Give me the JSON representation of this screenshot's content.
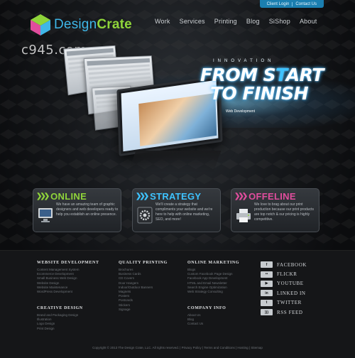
{
  "colors": {
    "brand_blue": "#3fb7e8",
    "brand_green": "#8fd43a",
    "accent_pink": "#e04d9d",
    "util_bar": "#1b7fb0"
  },
  "util": {
    "login": "Client Login",
    "contact": "Contact Us"
  },
  "logo": {
    "part1": "Design",
    "part2": "Crate",
    "icon": "cube-logo-icon"
  },
  "nav": [
    "Work",
    "Services",
    "Printing",
    "Blog",
    "SiShop",
    "About"
  ],
  "watermark": "c945.com",
  "hero": {
    "kicker": "INNOVATION",
    "title_pre": "FROM S",
    "title_accent": "T",
    "title_post": "ART",
    "title_line2": "TO FINISH",
    "caption": "Web Development"
  },
  "services": [
    {
      "title": "ONLINE",
      "icon": "monitor-icon",
      "desc": "We have an amazing team of graphic designers and web developers ready to help you establish an online presence."
    },
    {
      "title": "STRATEGY",
      "icon": "gear-icon",
      "desc": "We'll create a strategy that compliments your website and we're here to help with online marketing, SEO, and more!"
    },
    {
      "title": "OFFELINE",
      "icon": "printer-icon",
      "desc": "We love to brag about our print production because our print products are top notch & our pricing is highly competitive."
    }
  ],
  "footer": {
    "web_dev": {
      "heading": "WEBSITE DEVELOPMENT",
      "items": [
        "Content Management System",
        "Ecommerce Development",
        "Small Business Web Design",
        "Website Design",
        "Website Maintenance",
        "WordPress Development"
      ]
    },
    "creative": {
      "heading": "CREATIVE DESIGN",
      "items": [
        "Brand and Packaging Design",
        "Illustration",
        "Logo Design",
        "Print Design"
      ]
    },
    "printing": {
      "heading": "QUALITY PRINTING",
      "items": [
        "Brochures",
        "Business Cards",
        "CD Covers",
        "Door Hangers",
        "Indoor/Outdoor Banners",
        "Magnets",
        "Posters",
        "Postcards",
        "Stickers",
        "Signage"
      ]
    },
    "marketing": {
      "heading": "ONLINE MARKETING",
      "items": [
        "Blogs",
        "Custom Facebook Page Design",
        "Facebook App Development",
        "HTML and Email Newsletter",
        "Search Engine Optimization",
        "Web Strategy Consulting"
      ]
    },
    "company": {
      "heading": "COMPANY INFO",
      "items": [
        "About Us",
        "Blog",
        "Contact Us"
      ]
    },
    "social": [
      {
        "label": "FACEBOOK",
        "icon": "facebook-icon",
        "glyph": "f"
      },
      {
        "label": "FLICKR",
        "icon": "flickr-icon",
        "glyph": "••"
      },
      {
        "label": "YOUTUBE",
        "icon": "youtube-icon",
        "glyph": "▶"
      },
      {
        "label": "LINKED IN",
        "icon": "linkedin-icon",
        "glyph": "in"
      },
      {
        "label": "TWITTER",
        "icon": "twitter-icon",
        "glyph": "t"
      },
      {
        "label": "RSS FEED",
        "icon": "rss-icon",
        "glyph": ")))"
      }
    ],
    "copyright": "Copyright © 2013 The Design Crate, LLC. All rights reserved.  |  Privacy Policy  |  Terms and Conditions  |  Hosting  |  Sitemap"
  }
}
